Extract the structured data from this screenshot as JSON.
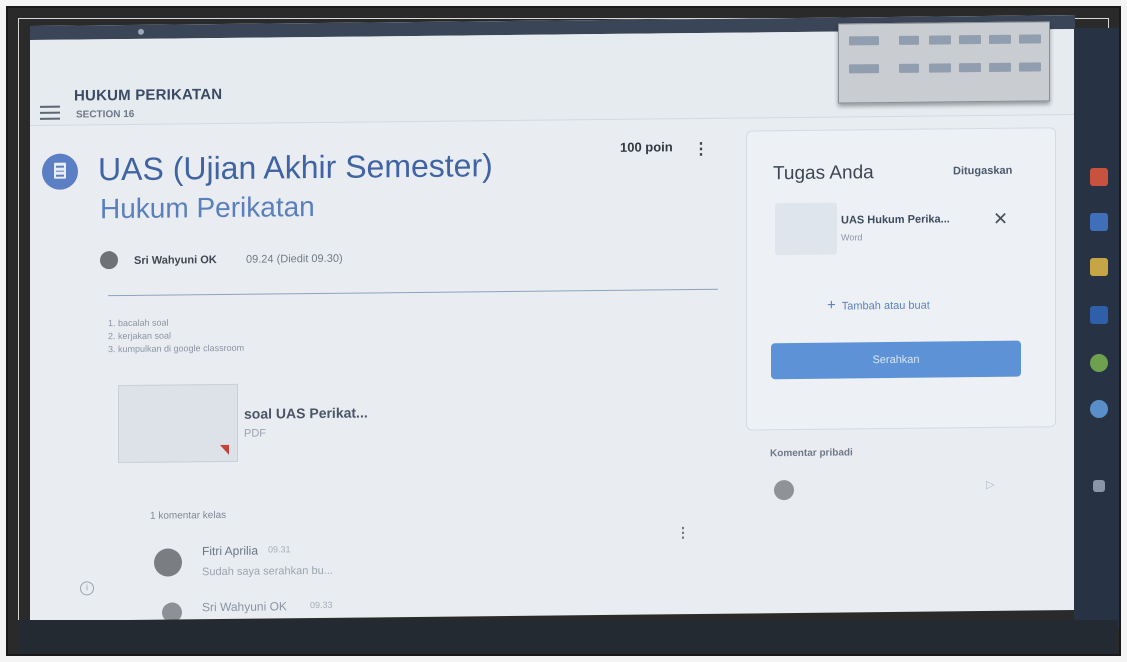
{
  "header": {
    "course_title": "HUKUM PERIKATAN",
    "course_section": "SECTION 16"
  },
  "assignment": {
    "title_line1": "UAS (Ujian Akhir Semester)",
    "title_line2": "Hukum Perikatan",
    "points": "100 poin",
    "author": "Sri Wahyuni OK",
    "time": "09.24 (Diedit 09.30)",
    "instructions": [
      "1. bacalah soal",
      "2. kerjakan soal",
      "3. kumpulkan di google classroom"
    ],
    "attachment": {
      "name": "soal UAS Perikat...",
      "type": "PDF"
    }
  },
  "class_comments": {
    "count_label": "1 komentar kelas",
    "items": [
      {
        "name": "Fitri Aprilia",
        "time": "09.31",
        "text": "Sudah saya serahkan bu..."
      },
      {
        "name": "Sri Wahyuni OK",
        "time": "09.33"
      }
    ]
  },
  "your_work": {
    "title": "Tugas Anda",
    "status": "Ditugaskan",
    "file": {
      "name": "UAS Hukum Perika...",
      "type": "Word"
    },
    "add_label": "Tambah atau buat",
    "submit_label": "Serahkan",
    "private_label": "Komentar pribadi"
  },
  "icons": {
    "menu": "hamburger-menu-icon",
    "assignment": "assignment-icon",
    "more": "more-vertical-icon",
    "close": "close-icon",
    "add": "plus-icon",
    "send": "send-icon"
  },
  "colors": {
    "accent": "#3f63a3",
    "submit": "#5d92d6",
    "pdf_flag": "#c2413a",
    "taskbar": "#273245"
  }
}
